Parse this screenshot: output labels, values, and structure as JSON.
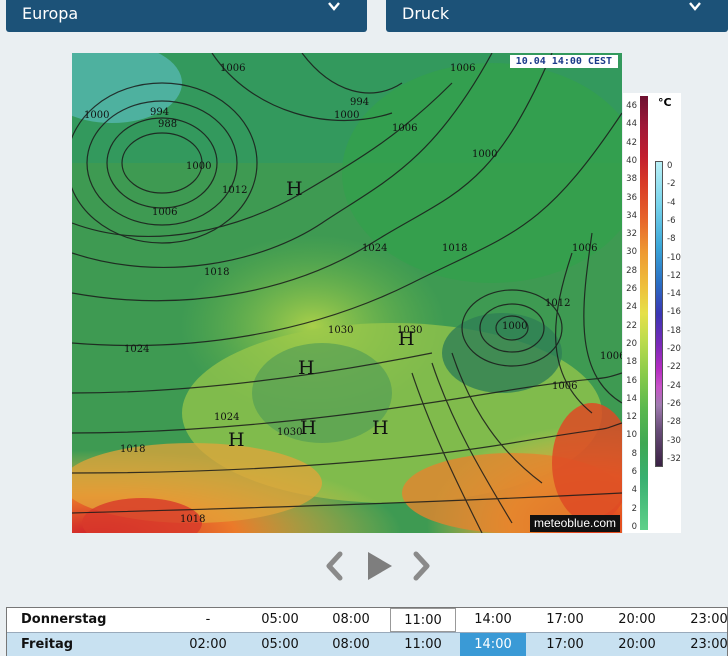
{
  "selectors": {
    "region": "Europa",
    "parameter": "Druck"
  },
  "map": {
    "timestamp": "10.04 14:00 CEST",
    "credit": "meteoblue.com",
    "pressure_labels": [
      "1006",
      "1000",
      "994",
      "988",
      "1000",
      "994",
      "1000",
      "1006",
      "1006",
      "1000",
      "1006",
      "1012",
      "1024",
      "1018",
      "1018",
      "1006",
      "1024",
      "1030",
      "1030",
      "1000",
      "1012",
      "1006",
      "1006",
      "1024",
      "1030",
      "1018",
      "1018"
    ],
    "systems": [
      "H",
      "H",
      "H",
      "H",
      "H",
      "H"
    ]
  },
  "legend": {
    "unit": "°C",
    "ramp_left": [
      "46",
      "44",
      "42",
      "40",
      "38",
      "36",
      "34",
      "32",
      "30",
      "28",
      "26",
      "24",
      "22",
      "20",
      "18",
      "16",
      "14",
      "12",
      "10",
      "8",
      "6",
      "4",
      "2",
      "0"
    ],
    "ramp_right": [
      "0",
      "-2",
      "-4",
      "-6",
      "-8",
      "-10",
      "-12",
      "-14",
      "-16",
      "-18",
      "-20",
      "-22",
      "-24",
      "-26",
      "-28",
      "-30",
      "-32"
    ]
  },
  "player": {
    "prev_icon": "chevron-left-icon",
    "play_icon": "play-icon",
    "next_icon": "chevron-right-icon"
  },
  "timeline": {
    "rows": [
      {
        "day": "Donnerstag",
        "times": [
          "-",
          "05:00",
          "08:00",
          "11:00",
          "14:00",
          "17:00",
          "20:00",
          "23:00"
        ],
        "current_index": 3
      },
      {
        "day": "Freitag",
        "times": [
          "02:00",
          "05:00",
          "08:00",
          "11:00",
          "14:00",
          "17:00",
          "20:00",
          "23:00"
        ],
        "selected_index": 4
      }
    ]
  },
  "colors": {
    "header": "#1c5278",
    "selected_time": "#3a9ad6",
    "row_highlight": "#c8e1f1"
  }
}
